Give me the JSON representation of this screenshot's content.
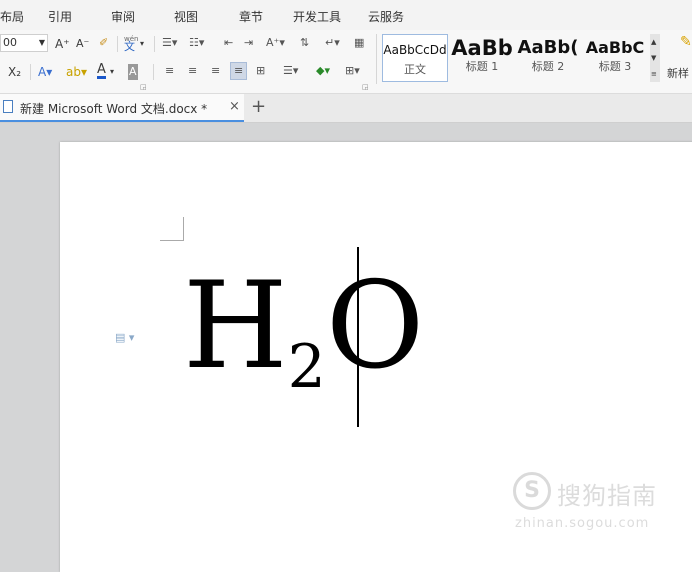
{
  "menu": [
    "布局",
    "引用",
    "审阅",
    "视图",
    "章节",
    "开发工具",
    "云服务"
  ],
  "toolbar": {
    "font_size": "00",
    "grow_font": "A⁺",
    "shrink_font": "A⁻",
    "wen_label": "wén",
    "wen_char": "文",
    "subscript": "X₂"
  },
  "styles": [
    {
      "sample": "AaBbCcDd",
      "name": "正文"
    },
    {
      "sample": "AaBb",
      "name": "标题 1"
    },
    {
      "sample": "AaBb(",
      "name": "标题 2"
    },
    {
      "sample": "AaBbC",
      "name": "标题 3"
    }
  ],
  "new_style_label": "新样",
  "tab": {
    "title": "新建 Microsoft Word 文档.docx *",
    "close": "×",
    "add": "+"
  },
  "document": {
    "main_1": "H",
    "subscript": "2",
    "main_2": "O"
  },
  "watermark": {
    "text": "搜狗指南",
    "url": "zhinan.sogou.com"
  },
  "colors": {
    "accent": "#4a8fe0",
    "highlight_yellow": "#f5d300",
    "font_red": "#1a57c9"
  }
}
